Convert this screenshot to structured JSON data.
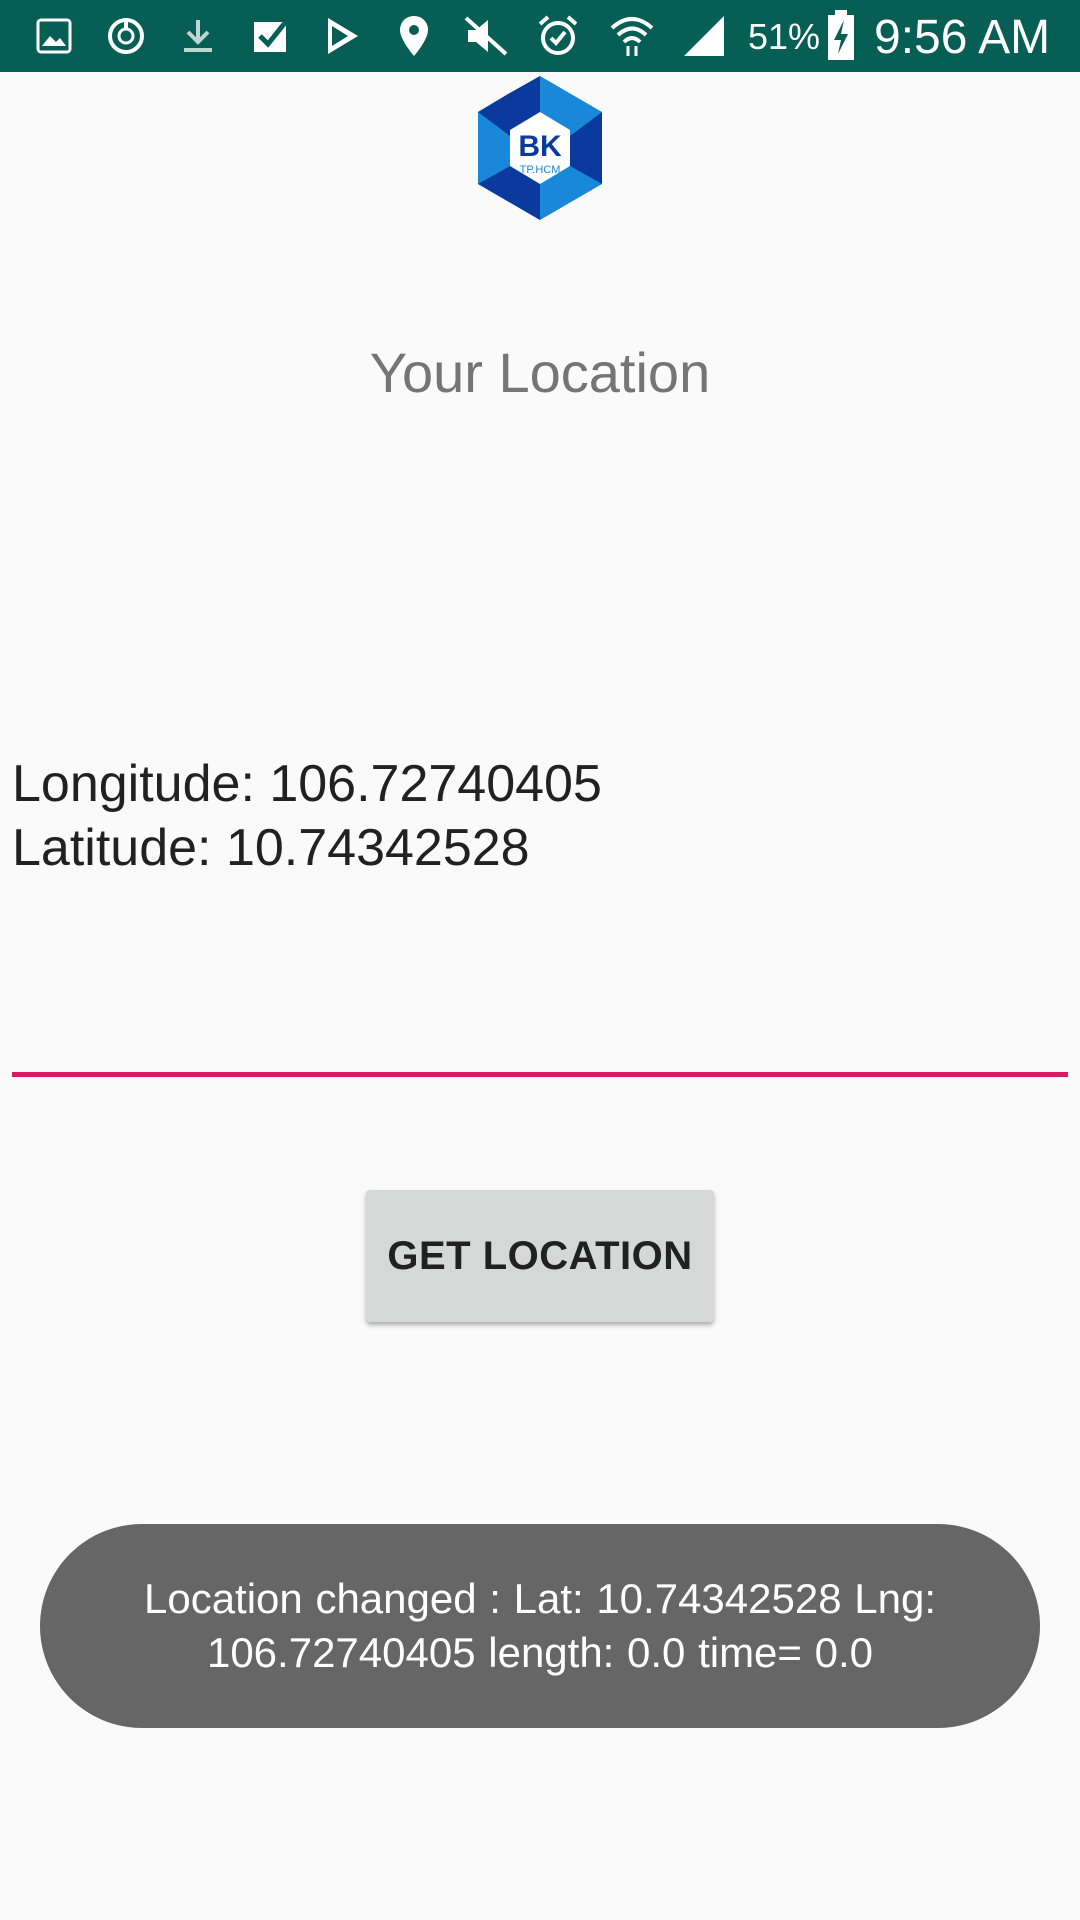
{
  "status_bar": {
    "icons": [
      "gallery-icon",
      "sync-icon",
      "download-icon",
      "check-icon",
      "play-store-icon",
      "location-icon",
      "mute-icon",
      "alarm-icon",
      "wifi-icon",
      "signal-icon"
    ],
    "battery": "51%",
    "time": "9:56 AM",
    "color": "#075e54"
  },
  "logo": {
    "text": "BK",
    "subtext": "TP.HCM",
    "colors": [
      "#0a3b9c",
      "#1a88d8"
    ]
  },
  "title": "Your Location",
  "location": {
    "longitude_line": "Longitude: 106.72740405",
    "latitude_line": "Latitude: 10.74342528"
  },
  "input_underline_color": "#d81b60",
  "button": {
    "label": "GET LOCATION"
  },
  "toast": {
    "text": "Location changed : Lat: 10.74342528 Lng: 106.72740405 length: 0.0 time= 0.0"
  }
}
